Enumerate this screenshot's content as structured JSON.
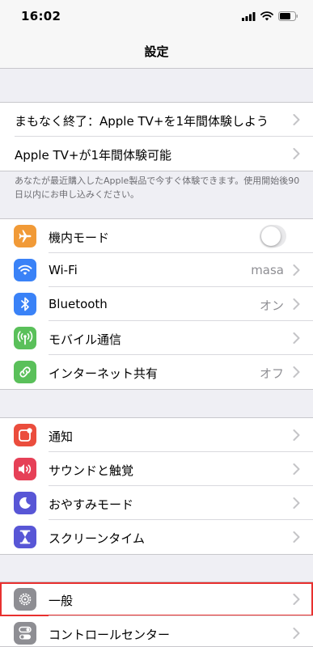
{
  "status_bar": {
    "time": "16:02",
    "signal_icon": "signal-bars-icon",
    "wifi_icon": "wifi-icon",
    "battery_icon": "battery-icon"
  },
  "nav": {
    "title": "設定"
  },
  "promo": {
    "rows": [
      {
        "label": "まもなく終了：Apple TV+を1年間体験しよう"
      },
      {
        "label": "Apple TV+が1年間体験可能"
      }
    ],
    "footnote": "あなたが最近購入したApple製品で今すぐ体験できます。使用開始後90日以内にお申し込みください。"
  },
  "connectivity": {
    "rows": [
      {
        "label": "機内モード",
        "icon": "airplane-icon",
        "color": "#f19a37",
        "toggle": false
      },
      {
        "label": "Wi-Fi",
        "icon": "wifi-icon",
        "color": "#3a82f7",
        "value": "masa"
      },
      {
        "label": "Bluetooth",
        "icon": "bluetooth-icon",
        "color": "#3a82f7",
        "value": "オン"
      },
      {
        "label": "モバイル通信",
        "icon": "antenna-icon",
        "color": "#5ac05a"
      },
      {
        "label": "インターネット共有",
        "icon": "link-icon",
        "color": "#5ac05a",
        "value": "オフ"
      }
    ]
  },
  "notifications": {
    "rows": [
      {
        "label": "通知",
        "icon": "notification-icon",
        "color": "#eb4d3d"
      },
      {
        "label": "サウンドと触覚",
        "icon": "speaker-icon",
        "color": "#e64057"
      },
      {
        "label": "おやすみモード",
        "icon": "moon-icon",
        "color": "#5856d6"
      },
      {
        "label": "スクリーンタイム",
        "icon": "hourglass-icon",
        "color": "#5856d6"
      }
    ]
  },
  "general": {
    "rows": [
      {
        "label": "一般",
        "icon": "gear-icon",
        "color": "#8e8e93",
        "highlighted": true
      },
      {
        "label": "コントロールセンター",
        "icon": "switches-icon",
        "color": "#8e8e93"
      }
    ]
  },
  "colors": {
    "highlight": "#e8302f",
    "chevron": "#c4c4c7"
  }
}
